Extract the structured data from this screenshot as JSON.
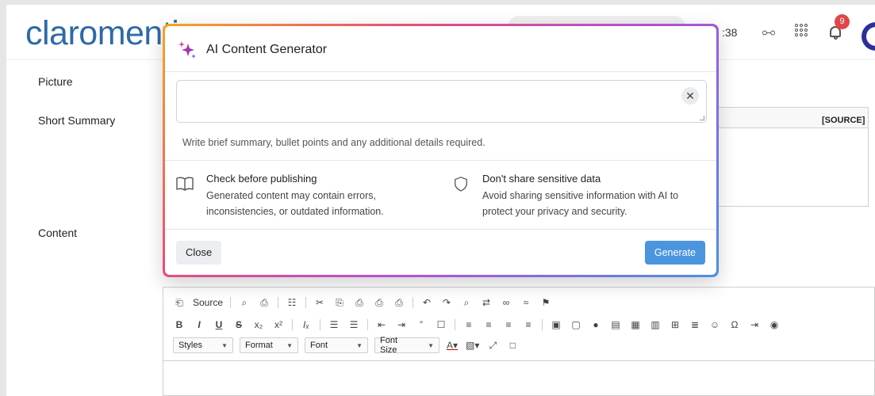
{
  "app": {
    "logo_text": "claromentis",
    "time_fragment": ":38",
    "notification_count": "9"
  },
  "form": {
    "picture_label": "Picture",
    "short_summary_label": "Short Summary",
    "content_label": "Content",
    "source_label": "[SOURCE]"
  },
  "editor": {
    "source_label": "Source",
    "combos": [
      "Styles",
      "Format",
      "Font",
      "Font Size"
    ]
  },
  "modal": {
    "title": "AI Content Generator",
    "prompt_value": "",
    "clear_label": "✕",
    "helper_text": "Write brief summary, bullet points and any additional details required.",
    "info": [
      {
        "icon": "book-icon",
        "title": "Check before publishing",
        "line1": "Generated content may contain errors,",
        "line2": "inconsistencies, or outdated information."
      },
      {
        "icon": "shield-icon",
        "title": "Don't share sensitive data",
        "line1": "Avoid sharing sensitive information with AI to",
        "line2": "protect your privacy and security."
      }
    ],
    "close_label": "Close",
    "generate_label": "Generate"
  },
  "colors": {
    "logo": "#2d6aa8",
    "generate_button": "#4a95dd",
    "badge": "#e2464a",
    "gradient": [
      "#f5a623",
      "#e94e77",
      "#b44fd6",
      "#4a90e2"
    ]
  }
}
